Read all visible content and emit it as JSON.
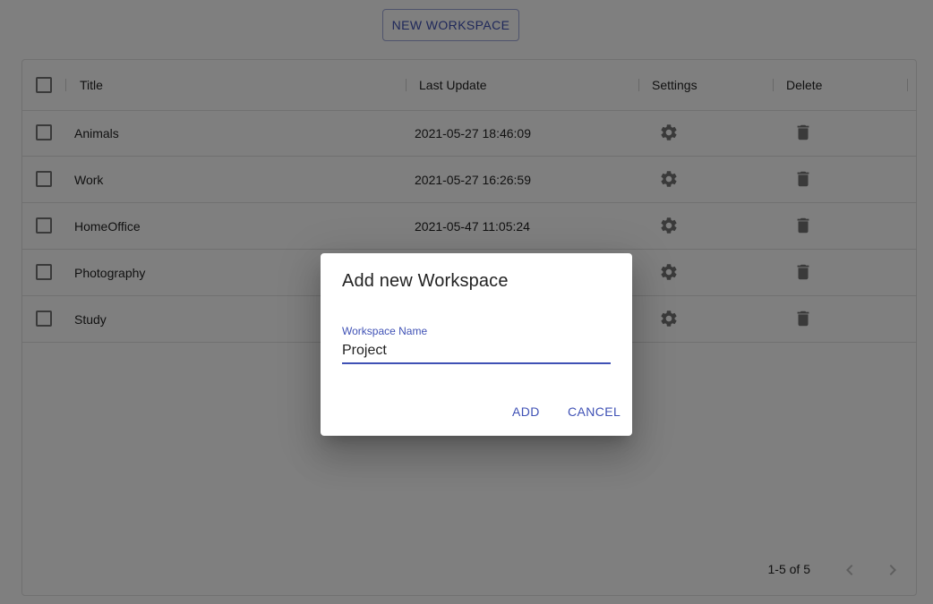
{
  "toolbar": {
    "new_workspace_label": "NEW WORKSPACE"
  },
  "table": {
    "columns": {
      "title": "Title",
      "last_update": "Last Update",
      "settings": "Settings",
      "delete": "Delete"
    },
    "rows": [
      {
        "title": "Animals",
        "last_update": "2021-05-27 18:46:09"
      },
      {
        "title": "Work",
        "last_update": "2021-05-27 16:26:59"
      },
      {
        "title": "HomeOffice",
        "last_update": "2021-05-47 11:05:24"
      },
      {
        "title": "Photography",
        "last_update": ""
      },
      {
        "title": "Study",
        "last_update": ""
      }
    ],
    "icons": {
      "settings": "gear-icon",
      "delete": "trash-icon"
    }
  },
  "pagination": {
    "range_text": "1-5 of 5",
    "prev_icon": "chevron-left-icon",
    "next_icon": "chevron-right-icon"
  },
  "dialog": {
    "title": "Add new Workspace",
    "field_label": "Workspace Name",
    "field_value": "Project",
    "add_label": "ADD",
    "cancel_label": "CANCEL"
  },
  "colors": {
    "accent": "#3f51b5",
    "backdrop": "rgba(0,0,0,0.5)"
  }
}
